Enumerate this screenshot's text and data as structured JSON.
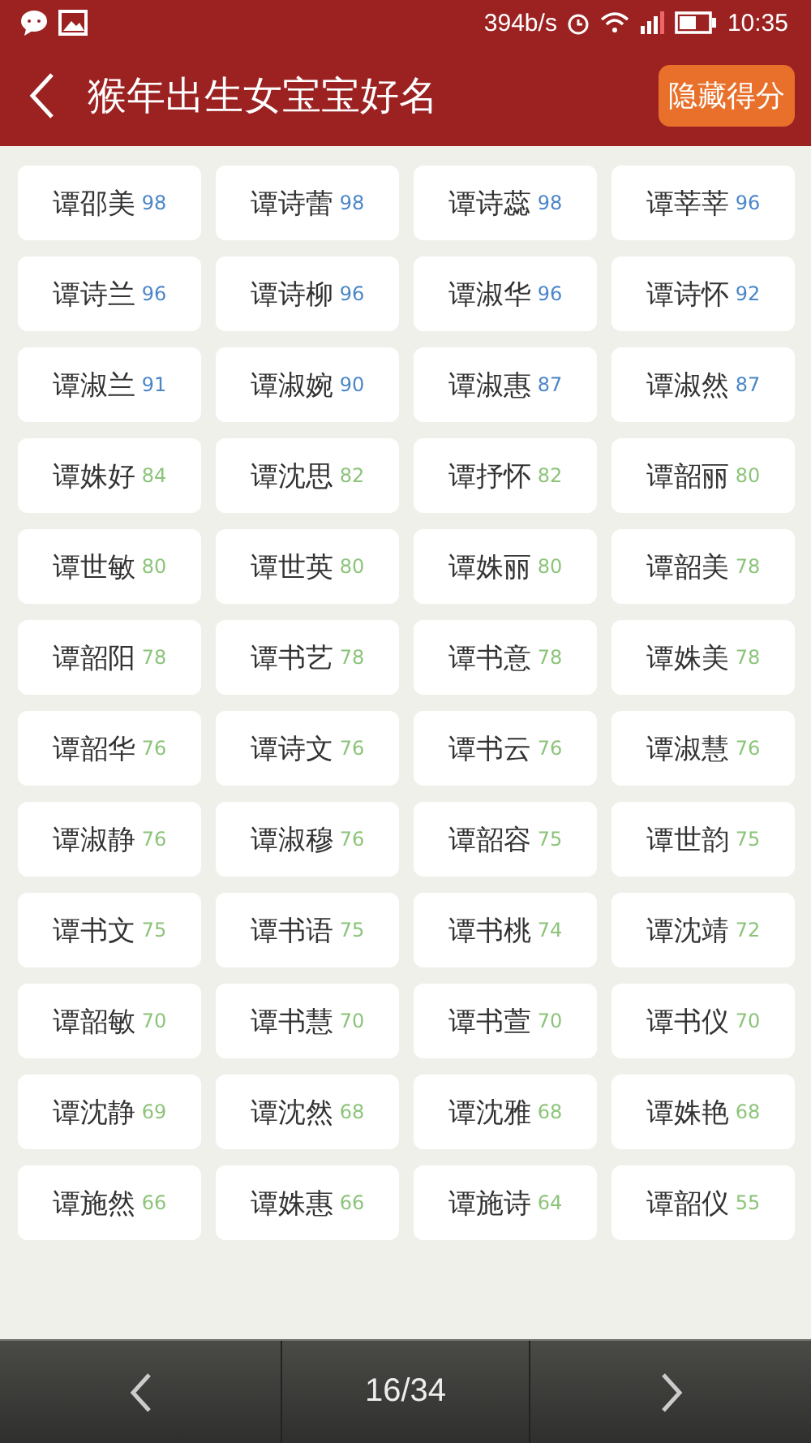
{
  "status_bar": {
    "speed": "394b/s",
    "time": "10:35"
  },
  "header": {
    "title": "猴年出生女宝宝好名",
    "action": "隐藏得分"
  },
  "names": [
    {
      "name": "谭邵美",
      "score": "98",
      "color": "#4a86c8"
    },
    {
      "name": "谭诗蕾",
      "score": "98",
      "color": "#4a86c8"
    },
    {
      "name": "谭诗蕊",
      "score": "98",
      "color": "#4a86c8"
    },
    {
      "name": "谭莘莘",
      "score": "96",
      "color": "#4a86c8"
    },
    {
      "name": "谭诗兰",
      "score": "96",
      "color": "#4a86c8"
    },
    {
      "name": "谭诗柳",
      "score": "96",
      "color": "#4a86c8"
    },
    {
      "name": "谭淑华",
      "score": "96",
      "color": "#4a86c8"
    },
    {
      "name": "谭诗怀",
      "score": "92",
      "color": "#4a86c8"
    },
    {
      "name": "谭淑兰",
      "score": "91",
      "color": "#4a86c8"
    },
    {
      "name": "谭淑婉",
      "score": "90",
      "color": "#4a86c8"
    },
    {
      "name": "谭淑惠",
      "score": "87",
      "color": "#4a86c8"
    },
    {
      "name": "谭淑然",
      "score": "87",
      "color": "#4a86c8"
    },
    {
      "name": "谭姝好",
      "score": "84",
      "color": "#8cc47a"
    },
    {
      "name": "谭沈思",
      "score": "82",
      "color": "#8cc47a"
    },
    {
      "name": "谭抒怀",
      "score": "82",
      "color": "#8cc47a"
    },
    {
      "name": "谭韶丽",
      "score": "80",
      "color": "#8cc47a"
    },
    {
      "name": "谭世敏",
      "score": "80",
      "color": "#8cc47a"
    },
    {
      "name": "谭世英",
      "score": "80",
      "color": "#8cc47a"
    },
    {
      "name": "谭姝丽",
      "score": "80",
      "color": "#8cc47a"
    },
    {
      "name": "谭韶美",
      "score": "78",
      "color": "#8cc47a"
    },
    {
      "name": "谭韶阳",
      "score": "78",
      "color": "#8cc47a"
    },
    {
      "name": "谭书艺",
      "score": "78",
      "color": "#8cc47a"
    },
    {
      "name": "谭书意",
      "score": "78",
      "color": "#8cc47a"
    },
    {
      "name": "谭姝美",
      "score": "78",
      "color": "#8cc47a"
    },
    {
      "name": "谭韶华",
      "score": "76",
      "color": "#8cc47a"
    },
    {
      "name": "谭诗文",
      "score": "76",
      "color": "#8cc47a"
    },
    {
      "name": "谭书云",
      "score": "76",
      "color": "#8cc47a"
    },
    {
      "name": "谭淑慧",
      "score": "76",
      "color": "#8cc47a"
    },
    {
      "name": "谭淑静",
      "score": "76",
      "color": "#8cc47a"
    },
    {
      "name": "谭淑穆",
      "score": "76",
      "color": "#8cc47a"
    },
    {
      "name": "谭韶容",
      "score": "75",
      "color": "#8cc47a"
    },
    {
      "name": "谭世韵",
      "score": "75",
      "color": "#8cc47a"
    },
    {
      "name": "谭书文",
      "score": "75",
      "color": "#8cc47a"
    },
    {
      "name": "谭书语",
      "score": "75",
      "color": "#8cc47a"
    },
    {
      "name": "谭书桃",
      "score": "74",
      "color": "#8cc47a"
    },
    {
      "name": "谭沈靖",
      "score": "72",
      "color": "#8cc47a"
    },
    {
      "name": "谭韶敏",
      "score": "70",
      "color": "#8cc47a"
    },
    {
      "name": "谭书慧",
      "score": "70",
      "color": "#8cc47a"
    },
    {
      "name": "谭书萱",
      "score": "70",
      "color": "#8cc47a"
    },
    {
      "name": "谭书仪",
      "score": "70",
      "color": "#8cc47a"
    },
    {
      "name": "谭沈静",
      "score": "69",
      "color": "#8cc47a"
    },
    {
      "name": "谭沈然",
      "score": "68",
      "color": "#8cc47a"
    },
    {
      "name": "谭沈雅",
      "score": "68",
      "color": "#8cc47a"
    },
    {
      "name": "谭姝艳",
      "score": "68",
      "color": "#8cc47a"
    },
    {
      "name": "谭施然",
      "score": "66",
      "color": "#8cc47a"
    },
    {
      "name": "谭姝惠",
      "score": "66",
      "color": "#8cc47a"
    },
    {
      "name": "谭施诗",
      "score": "64",
      "color": "#8cc47a"
    },
    {
      "name": "谭韶仪",
      "score": "55",
      "color": "#8cc47a"
    }
  ],
  "pager": {
    "page": "16/34"
  }
}
